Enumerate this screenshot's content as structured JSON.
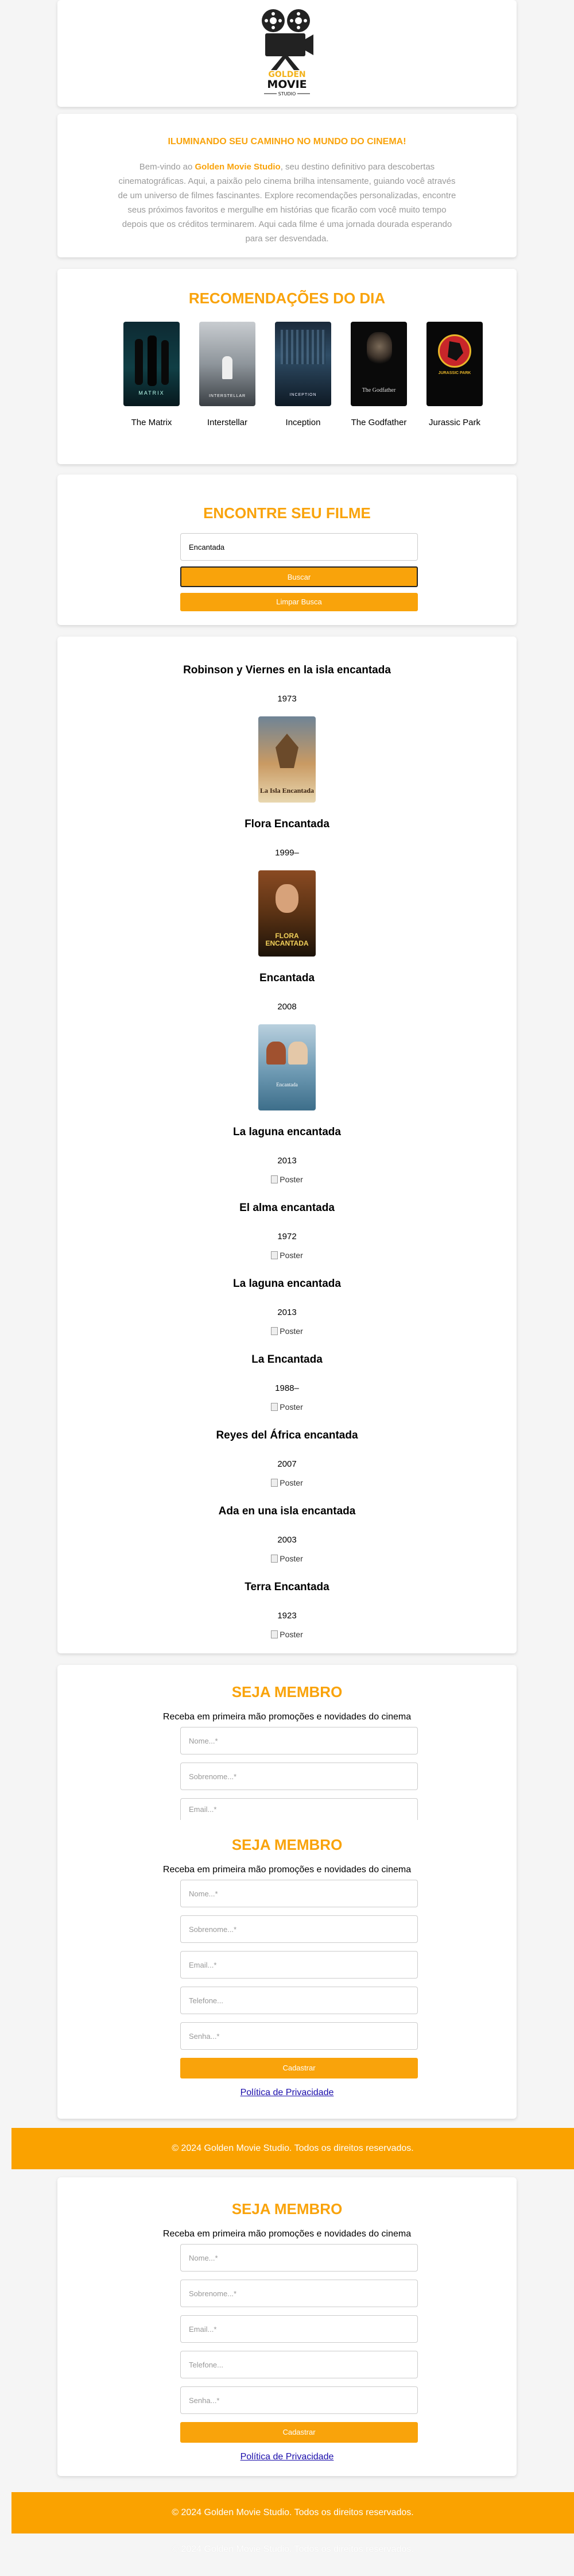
{
  "logo": {
    "line1": "GOLDEN",
    "line2": "MOVIE",
    "line3": "STUDIO"
  },
  "intro": {
    "title": "ILUMINANDO SEU CAMINHO NO MUNDO DO CINEMA!",
    "text_before": "Bem-vindo ao ",
    "brand": "Golden Movie Studio",
    "text_after": ", seu destino definitivo para descobertas cinematográficas. Aqui, a paixão pelo cinema brilha intensamente, guiando você através de um universo de filmes fascinantes. Explore recomendações personalizadas, encontre seus próximos favoritos e mergulhe em histórias que ficarão com você muito tempo depois que os créditos terminarem. Aqui cada filme é uma jornada dourada esperando para ser desvendada."
  },
  "recommendations": {
    "title": "RECOMENDAÇÕES DO DIA",
    "items": [
      {
        "title": "The Matrix",
        "poster_text": "MATRIX"
      },
      {
        "title": "Interstellar",
        "poster_text": "INTERSTELLAR"
      },
      {
        "title": "Inception",
        "poster_text": "INCEPTION"
      },
      {
        "title": "The Godfather",
        "poster_text": "The Godfather"
      },
      {
        "title": "Jurassic Park",
        "poster_text": "JURASSIC PARK"
      }
    ]
  },
  "search": {
    "title": "ENCONTRE SEU FILME",
    "value": "Encantada",
    "button": "Buscar",
    "clear": "Limpar Busca"
  },
  "results": [
    {
      "title": "Robinson y Viernes en la isla encantada",
      "year": "1973",
      "poster_text": "La Isla Encantada"
    },
    {
      "title": "Flora Encantada",
      "year": "1999–",
      "poster_text": "FLORA ENCANTADA"
    },
    {
      "title": "Encantada",
      "year": "2008",
      "poster_text": "Encantada"
    },
    {
      "title": "La laguna encantada",
      "year": "2013",
      "alt": "Poster"
    },
    {
      "title": "El alma encantada",
      "year": "1972",
      "alt": "Poster"
    },
    {
      "title": "La laguna encantada",
      "year": "2013",
      "alt": "Poster"
    },
    {
      "title": "La Encantada",
      "year": "1988–",
      "alt": "Poster"
    },
    {
      "title": "Reyes del África encantada",
      "year": "2007",
      "alt": "Poster"
    },
    {
      "title": "Ada en una isla encantada",
      "year": "2003",
      "alt": "Poster"
    },
    {
      "title": "Terra Encantada",
      "year": "1923",
      "alt": "Poster"
    }
  ],
  "membership": {
    "title": "SEJA MEMBRO",
    "subtitle": "Receba em primeira mão promoções e novidades do cinema",
    "placeholders": {
      "nome": "Nome...*",
      "sobrenome": "Sobrenome...*",
      "email": "Email...*",
      "telefone": "Telefone...",
      "senha": "Senha...*"
    },
    "button": "Cadastrar",
    "privacy": "Política de Privacidade"
  },
  "footer": {
    "text": "© 2024 Golden Movie Studio. Todos os direitos reservados."
  },
  "colors": {
    "accent": "#f9a30b",
    "footer": "#faa200"
  }
}
